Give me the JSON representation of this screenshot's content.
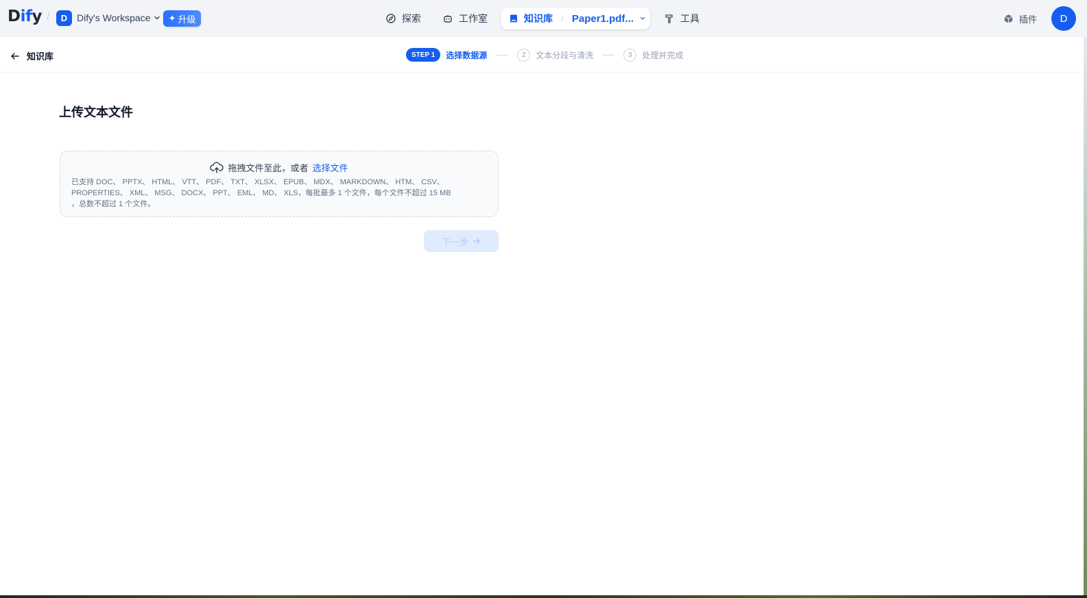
{
  "brand": {
    "logo_prefix": "D",
    "logo_mid": "if",
    "logo_suffix": "y"
  },
  "workspace": {
    "avatar_letter": "D",
    "name": "Dify's Workspace",
    "upgrade_label": "升级"
  },
  "nav": {
    "explore": "探索",
    "studio": "工作室",
    "knowledge": "知识库",
    "current_doc": "Paper1.pdf...",
    "tools": "工具",
    "plugins": "插件",
    "user_avatar": "D"
  },
  "subheader": {
    "back_label": "知识库",
    "steps": [
      {
        "badge": "STEP 1",
        "label": "选择数据源",
        "state": "active"
      },
      {
        "badge": "2",
        "label": "文本分段与清洗",
        "state": "pending"
      },
      {
        "badge": "3",
        "label": "处理并完成",
        "state": "pending"
      }
    ]
  },
  "main": {
    "title": "上传文本文件",
    "dropzone": {
      "prompt": "拖拽文件至此，或者",
      "link": "选择文件",
      "desc_line1": "已支持 DOC、 PPTX、 HTML、 VTT、 PDF、 TXT、 XLSX、 EPUB、 MDX、 MARKDOWN、 HTM、 CSV、",
      "desc_line2": "PROPERTIES、 XML、 MSG、 DOCX、 PPT、 EML、 MD、 XLS，每批最多 1 个文件，每个文件不超过 15 MB",
      "desc_line3": "，总数不超过 1 个文件。"
    },
    "next_button": "下一步"
  },
  "colors": {
    "accent": "#155eef",
    "muted": "#98a2b3",
    "bg": "#f2f4f7"
  }
}
